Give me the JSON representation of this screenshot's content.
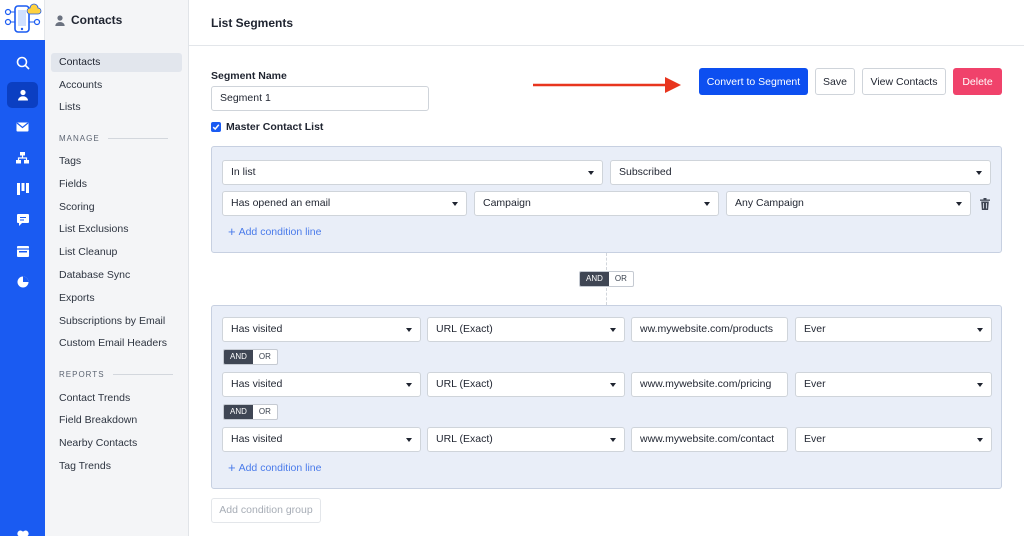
{
  "sidebar": {
    "header": "Contacts",
    "items": [
      {
        "label": "Contacts",
        "active": true
      },
      {
        "label": "Accounts"
      },
      {
        "label": "Lists"
      }
    ],
    "manage_title": "MANAGE",
    "manage_items": [
      "Tags",
      "Fields",
      "Scoring",
      "List Exclusions",
      "List Cleanup",
      "Database Sync",
      "Exports",
      "Subscriptions by Email",
      "Custom Email Headers"
    ],
    "reports_title": "REPORTS",
    "reports_items": [
      "Contact Trends",
      "Field Breakdown",
      "Nearby Contacts",
      "Tag Trends"
    ]
  },
  "rail_icons": [
    "search-icon",
    "contacts-icon",
    "email-icon",
    "automation-icon",
    "pipeline-icon",
    "conversations-icon",
    "site-icon",
    "reports-icon",
    "heart-icon"
  ],
  "page": {
    "title": "List Segments",
    "segment_name_label": "Segment Name",
    "segment_name_value": "Segment 1",
    "master_list_label": "Master Contact List"
  },
  "actions": {
    "convert": "Convert to Segment",
    "save": "Save",
    "view": "View Contacts",
    "delete": "Delete"
  },
  "group1": {
    "row1": [
      "In list",
      "Subscribed"
    ],
    "row2": [
      "Has opened an email",
      "Campaign",
      "Any Campaign"
    ],
    "add_line": "Add condition line"
  },
  "group_join": {
    "and": "AND",
    "or": "OR"
  },
  "group2": {
    "rows": [
      [
        "Has visited",
        "URL (Exact)",
        "ww.mywebsite.com/products",
        "Ever"
      ],
      [
        "Has visited",
        "URL (Exact)",
        "www.mywebsite.com/pricing",
        "Ever"
      ],
      [
        "Has visited",
        "URL (Exact)",
        "www.mywebsite.com/contact",
        "Ever"
      ]
    ],
    "and": "AND",
    "or": "OR",
    "add_line": "Add condition line"
  },
  "add_group": "Add condition group",
  "colors": {
    "brand": "#1a5bf2",
    "primary_button": "#0d4ff0",
    "danger": "#f0426b",
    "arrow": "#e8351e",
    "group_bg": "#e9eef8"
  }
}
